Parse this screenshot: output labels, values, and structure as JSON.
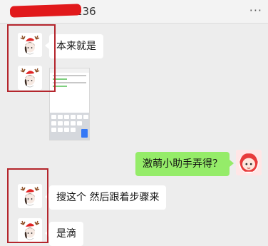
{
  "header": {
    "title": "136",
    "more_icon": "more-dots-icon",
    "more_label": "···"
  },
  "messages": [
    {
      "side": "left",
      "text": "本来就是"
    },
    {
      "side": "left",
      "type": "image",
      "description_icon": "phone-screenshot-thumbnail"
    },
    {
      "side": "right",
      "text": "激萌小助手弄得？"
    },
    {
      "side": "left",
      "text": "搜这个 然后跟着步骤来"
    },
    {
      "side": "left",
      "text": "是滴"
    }
  ],
  "colors": {
    "background": "#ededed",
    "my_bubble": "#95ec69",
    "their_bubble": "#ffffff",
    "highlight_box": "#b4252c",
    "redaction": "#e1191b"
  }
}
